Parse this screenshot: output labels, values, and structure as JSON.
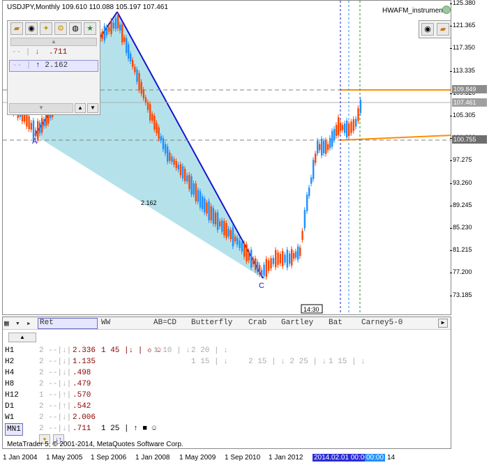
{
  "chart": {
    "title": "USDJPY,Monthly  109.610 110.088 105.197 107.461",
    "indicator_name": "HWAFM_instrument",
    "price_axis": [
      "125.380",
      "121.365",
      "117.350",
      "113.335",
      "109.320",
      "105.305",
      "101.290",
      "97.275",
      "93.260",
      "89.245",
      "85.230",
      "81.215",
      "77.200",
      "73.185"
    ],
    "price_labels": {
      "upper": "109.849",
      "current": "107.461",
      "lower": "100.755"
    },
    "pattern_labels": {
      "a": "A",
      "c": "C",
      "ratio": "2.162"
    },
    "time_label": "14:30"
  },
  "mini_panel": {
    "rows": [
      {
        "prefix": "-- | ↓",
        "value": ".711"
      },
      {
        "prefix": "↑",
        "value": "2.162"
      }
    ]
  },
  "bottom_panel": {
    "tabs": [
      "Ret",
      "WW",
      "AB=CD",
      "Butterfly",
      "Crab",
      "Gartley",
      "Bat",
      "Carney5-0"
    ],
    "rows": [
      {
        "tf": "H1",
        "cols": [
          "2 --|↓|",
          "2.336",
          "1 45 |↓ | ☼ ☺",
          "1 10 | ↓",
          "2 20 | ↓"
        ]
      },
      {
        "tf": "H2",
        "cols": [
          "2 --|↓|",
          "1.135",
          "",
          "1 15 | ↓",
          "2 15 | ↓   2 25 | ↓",
          "1 15 | ↓"
        ]
      },
      {
        "tf": "H4",
        "cols": [
          "2 --|↓|",
          ".498"
        ]
      },
      {
        "tf": "H8",
        "cols": [
          "2 --|↓|",
          ".479"
        ]
      },
      {
        "tf": "H12",
        "cols": [
          "1 --|↑|",
          ".570"
        ]
      },
      {
        "tf": "D1",
        "cols": [
          "2 --|↑|",
          ".542"
        ]
      },
      {
        "tf": "W1",
        "cols": [
          "2 --|↓|",
          "2.006"
        ]
      },
      {
        "tf": "MN1",
        "cols": [
          "2 --|↓|",
          ".711",
          "1 25 | ↑ ■ ☺"
        ]
      }
    ],
    "copyright": "MetaTrader 5, © 2001-2014, MetaQuotes Software Corp."
  },
  "time_axis": [
    "1 Jan 2004",
    "1 May 2005",
    "1 Sep 2006",
    "1 Jan 2008",
    "1 May 2009",
    "1 Sep 2010",
    "1 Jan 2012",
    "2014.02.01 00:00",
    "00:00",
    "14"
  ],
  "colors": {
    "bull": "#1e90ff",
    "bear": "#ff4500",
    "pattern_fill": "#a8dde6",
    "pattern_line": "#1515d0",
    "level_orange": "#ff8c00"
  }
}
